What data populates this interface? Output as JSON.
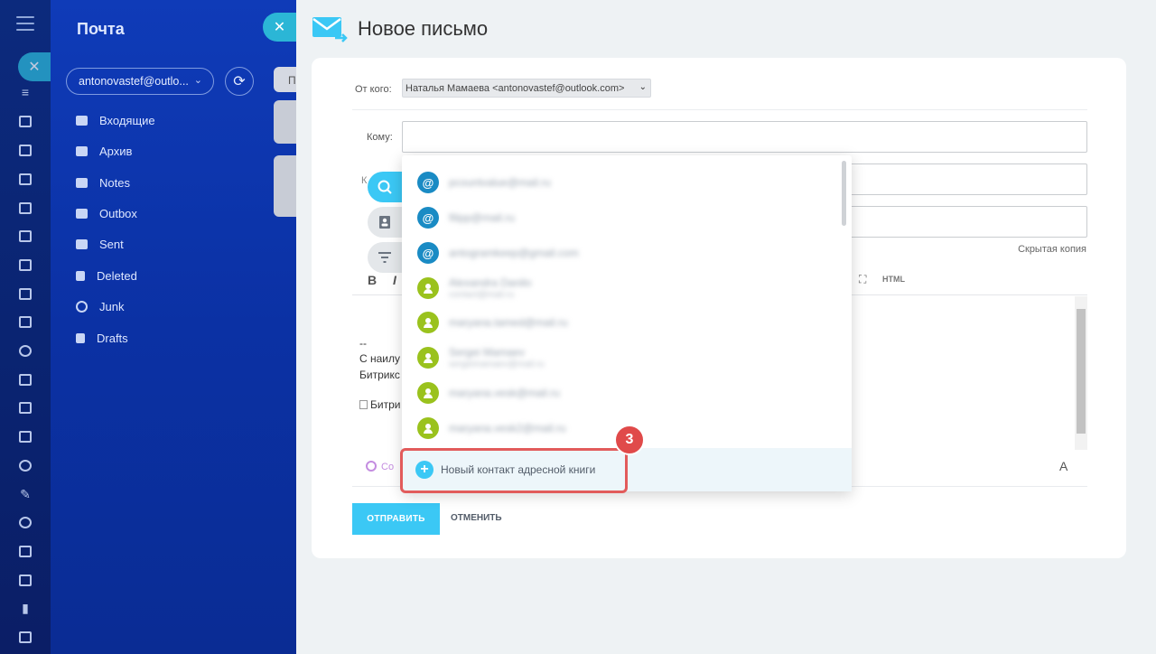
{
  "mail_panel": {
    "title": "Почта",
    "account": "antonovastef@outlo...",
    "folders": [
      "Входящие",
      "Архив",
      "Notes",
      "Outbox",
      "Sent",
      "Deleted",
      "Junk",
      "Drafts"
    ],
    "peek_label": "П"
  },
  "compose": {
    "title": "Новое письмо",
    "from_label": "От кого:",
    "from_value": "Наталья Мамаева <antonovastef@outlook.com>",
    "to_label": "Кому:",
    "cc_side": "К",
    "hidden_copy": "Скрытая копия",
    "toolbar_bold": "B",
    "toolbar_italic": "I",
    "toolbar_html": "HTML",
    "signature": {
      "dash": "--",
      "line1": "С наилу",
      "line2": "Битрикс",
      "image_alt": "Битри"
    },
    "copilot_label": "Co",
    "font_btn": "A",
    "send": "ОТПРАВИТЬ",
    "cancel": "ОТМЕНИТЬ"
  },
  "dropdown": {
    "items": [
      {
        "type": "email",
        "text": "pcountvalue@mail.ru"
      },
      {
        "type": "email",
        "text": "filipp@mail.ru"
      },
      {
        "type": "email",
        "text": "antogramkeep@gmail.com"
      },
      {
        "type": "contact",
        "text": "Alexandra Danilo",
        "sub": "contact@mail.ru"
      },
      {
        "type": "contact",
        "text": "maryana.tamed@mail.ru"
      },
      {
        "type": "contact",
        "text": "Sergei Mamaev",
        "sub": "sergeimamaev@mail.ru"
      },
      {
        "type": "contact",
        "text": "maryana.vesk@mail.ru"
      },
      {
        "type": "contact",
        "text": "maryana.vesk2@mail.ru"
      }
    ],
    "new_contact": "Новый контакт адресной книги"
  },
  "annotation": {
    "step": "3",
    "color": "#e04a4a"
  }
}
